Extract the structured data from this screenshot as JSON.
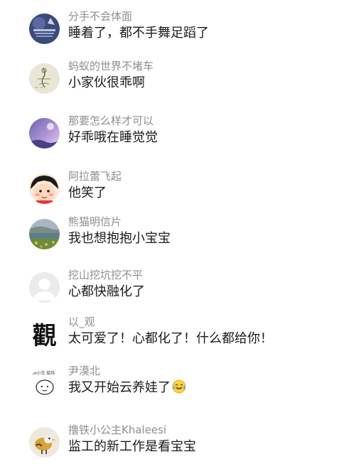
{
  "comments": [
    {
      "username": "分手不会体面",
      "text": "睡着了，都不手舞足蹈了",
      "avatar": "dark-blue-avatar"
    },
    {
      "username": "蚂蚁的世界不堵车",
      "text": "小家伙很乖啊",
      "avatar": "sketch-avatar"
    },
    {
      "username": "那要怎么样才可以",
      "text": "好乖哦在睡觉觉",
      "avatar": "purple-sky-avatar"
    },
    {
      "username": "阿拉蕾飞起",
      "text": "他笑了",
      "avatar": "cartoon-girl-avatar"
    },
    {
      "username": "熊猫明信片",
      "text": "我也想抱抱小宝宝",
      "avatar": "landscape-avatar"
    },
    {
      "username": "挖山挖坑挖不平",
      "text": "心都快融化了",
      "avatar": "default-user-avatar"
    },
    {
      "username": "以_观",
      "text": "太可爱了！心都化了！什么都给你！",
      "avatar": "calligraphy-avatar"
    },
    {
      "username": "尹漠北",
      "text": "我又开始云养娃了",
      "avatar": "doodle-avatar",
      "emoji": "tears-of-joy-emoji"
    },
    {
      "username": "撸铁小公主Khaleesi",
      "text": "监工的新工作是看宝宝",
      "avatar": "bird-avatar"
    }
  ],
  "calligraphy_char": "觀",
  "doodle_text": "Yo小王 给你"
}
